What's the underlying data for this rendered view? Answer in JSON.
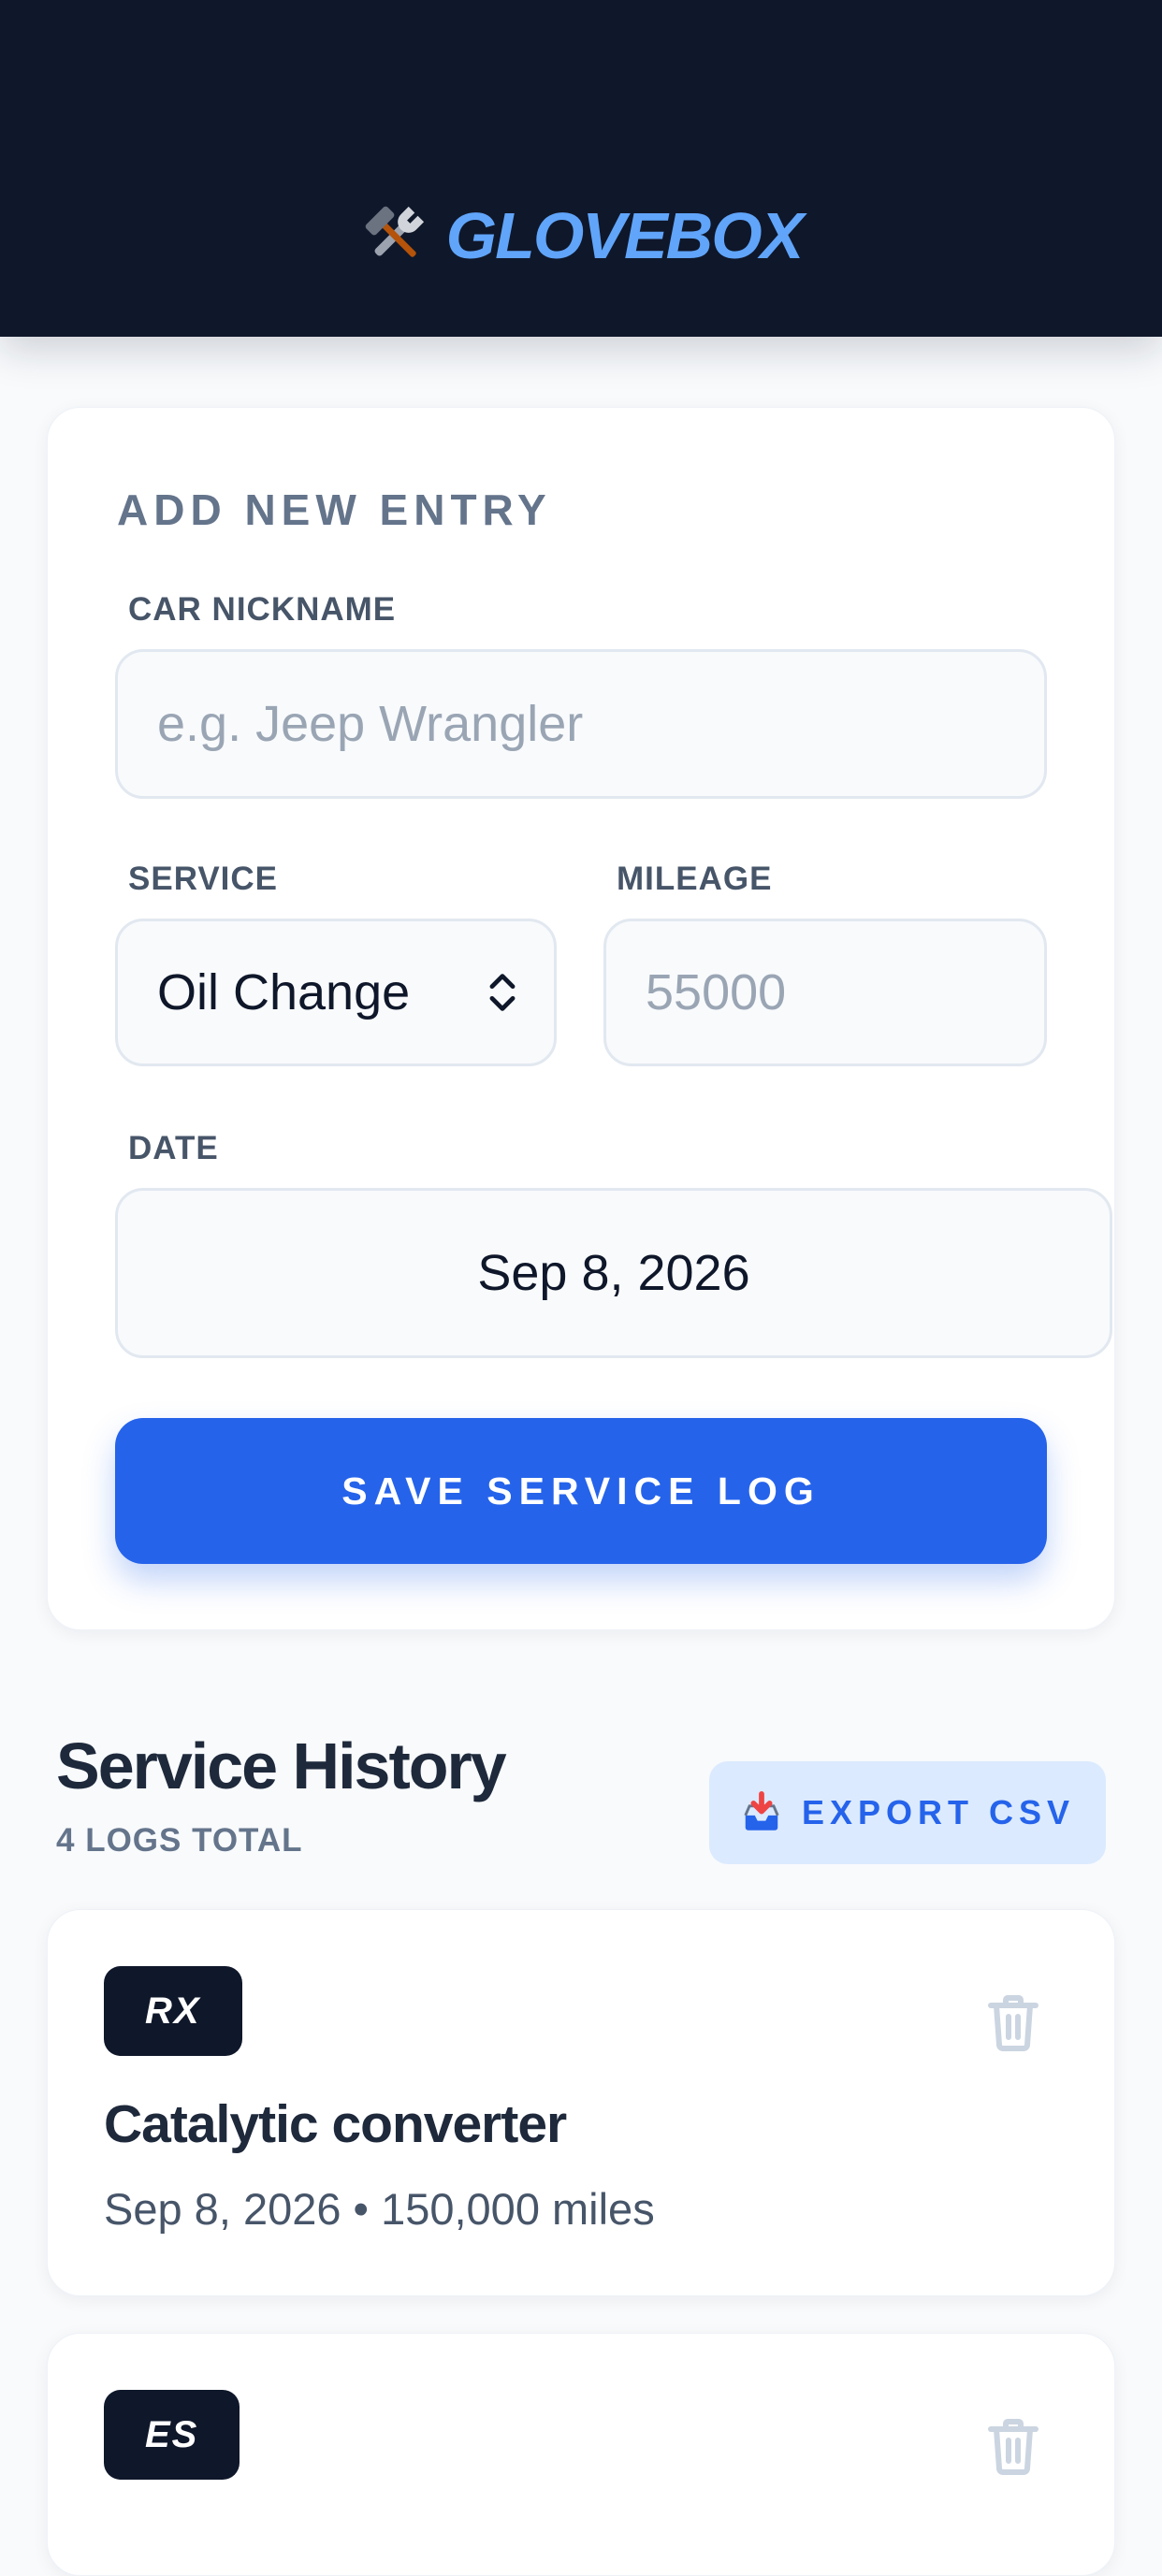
{
  "app": {
    "title": "GLOVEBOX",
    "logo_icon": "hammer-and-wrench-icon"
  },
  "form": {
    "section_title": "ADD NEW ENTRY",
    "nickname": {
      "label": "CAR NICKNAME",
      "value": "",
      "placeholder": "e.g. Jeep Wrangler"
    },
    "service": {
      "label": "SERVICE",
      "selected": "Oil Change"
    },
    "mileage": {
      "label": "MILEAGE",
      "value": "",
      "placeholder": "55000"
    },
    "date": {
      "label": "DATE",
      "value": "Sep 8, 2026"
    },
    "save_label": "SAVE SERVICE LOG"
  },
  "history": {
    "title": "Service History",
    "count_label": "4 LOGS TOTAL",
    "export_label": "EXPORT CSV",
    "export_icon": "inbox-tray-icon",
    "logs": [
      {
        "badge": "RX",
        "service": "Catalytic converter",
        "meta": "Sep 8, 2026 • 150,000 miles"
      },
      {
        "badge": "ES"
      }
    ]
  },
  "colors": {
    "header_bg": "#0f172a",
    "brand_accent": "#60a5fa",
    "primary": "#2563eb",
    "export_bg": "#dbeafe",
    "badge_bg": "#0f172a"
  }
}
